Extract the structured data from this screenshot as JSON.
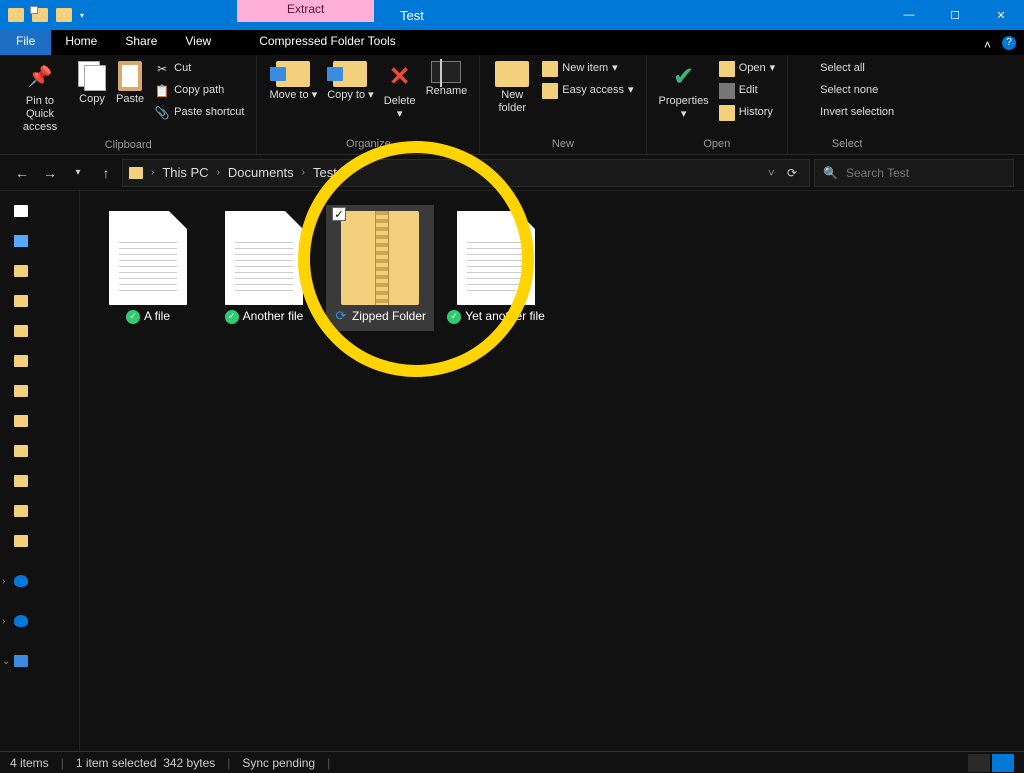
{
  "titlebar": {
    "contextual_tab": "Extract",
    "contextual_group": "Compressed Folder Tools",
    "title": "Test"
  },
  "tabs": {
    "file": "File",
    "home": "Home",
    "share": "Share",
    "view": "View",
    "tool": "Compressed Folder Tools"
  },
  "ribbon": {
    "clipboard": {
      "label": "Clipboard",
      "pin": "Pin to Quick access",
      "copy": "Copy",
      "paste": "Paste",
      "cut": "Cut",
      "copy_path": "Copy path",
      "paste_shortcut": "Paste shortcut"
    },
    "organize": {
      "label": "Organize",
      "move_to": "Move to",
      "copy_to": "Copy to",
      "delete": "Delete",
      "rename": "Rename"
    },
    "new": {
      "label": "New",
      "new_folder": "New folder",
      "new_item": "New item",
      "easy_access": "Easy access"
    },
    "open": {
      "label": "Open",
      "properties": "Properties",
      "open": "Open",
      "edit": "Edit",
      "history": "History"
    },
    "select": {
      "label": "Select",
      "select_all": "Select all",
      "select_none": "Select none",
      "invert": "Invert selection"
    }
  },
  "address": {
    "segments": [
      "This PC",
      "Documents",
      "Test"
    ]
  },
  "search": {
    "placeholder": "Search Test"
  },
  "files": [
    {
      "name": "A file",
      "type": "doc",
      "status": "synced",
      "selected": false
    },
    {
      "name": "Another file",
      "type": "doc",
      "status": "synced",
      "selected": false
    },
    {
      "name": "Zipped Folder",
      "type": "zip",
      "status": "syncing",
      "selected": true
    },
    {
      "name": "Yet another file",
      "type": "doc",
      "status": "synced",
      "selected": false
    }
  ],
  "status": {
    "count": "4 items",
    "selected": "1 item selected",
    "size": "342 bytes",
    "sync": "Sync pending"
  }
}
